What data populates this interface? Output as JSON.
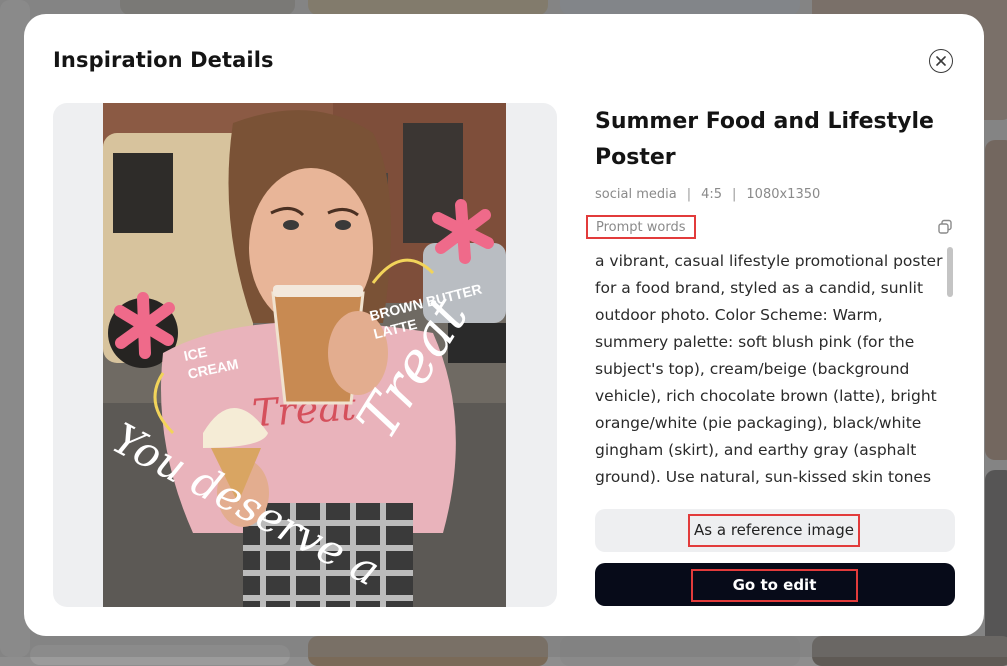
{
  "modal": {
    "title": "Inspiration Details",
    "close_icon": "close-icon"
  },
  "poster": {
    "alt_text_lines": [
      "ICE",
      "CREAM",
      "BROWN BUTTER",
      "LATTE",
      "Treat",
      "You deserve a"
    ],
    "tee_text": "Treat"
  },
  "detail": {
    "title": "Summer Food and Lifestyle Poster",
    "meta": {
      "category": "social media",
      "ratio": "4:5",
      "size": "1080x1350",
      "separator": "|"
    },
    "prompt_label": "Prompt words",
    "copy_icon": "copy-icon",
    "prompt_text": "a vibrant, casual lifestyle promotional poster for a food brand, styled as a candid, sunlit outdoor photo. Color Scheme: Warm, summery palette: soft blush pink (for the subject's top), cream/beige (background vehicle), rich chocolate brown (latte), bright orange/white (pie packaging), black/white gingham (skirt), and earthy gray (asphalt ground). Use natural, sun-kissed skin tones",
    "reference_button": "As a reference image",
    "edit_button": "Go to edit"
  },
  "colors": {
    "highlight": "#e23b3b",
    "primary_button": "#070b19",
    "secondary_button": "#eeeff1",
    "accent_pink": "#ef6a8a"
  }
}
